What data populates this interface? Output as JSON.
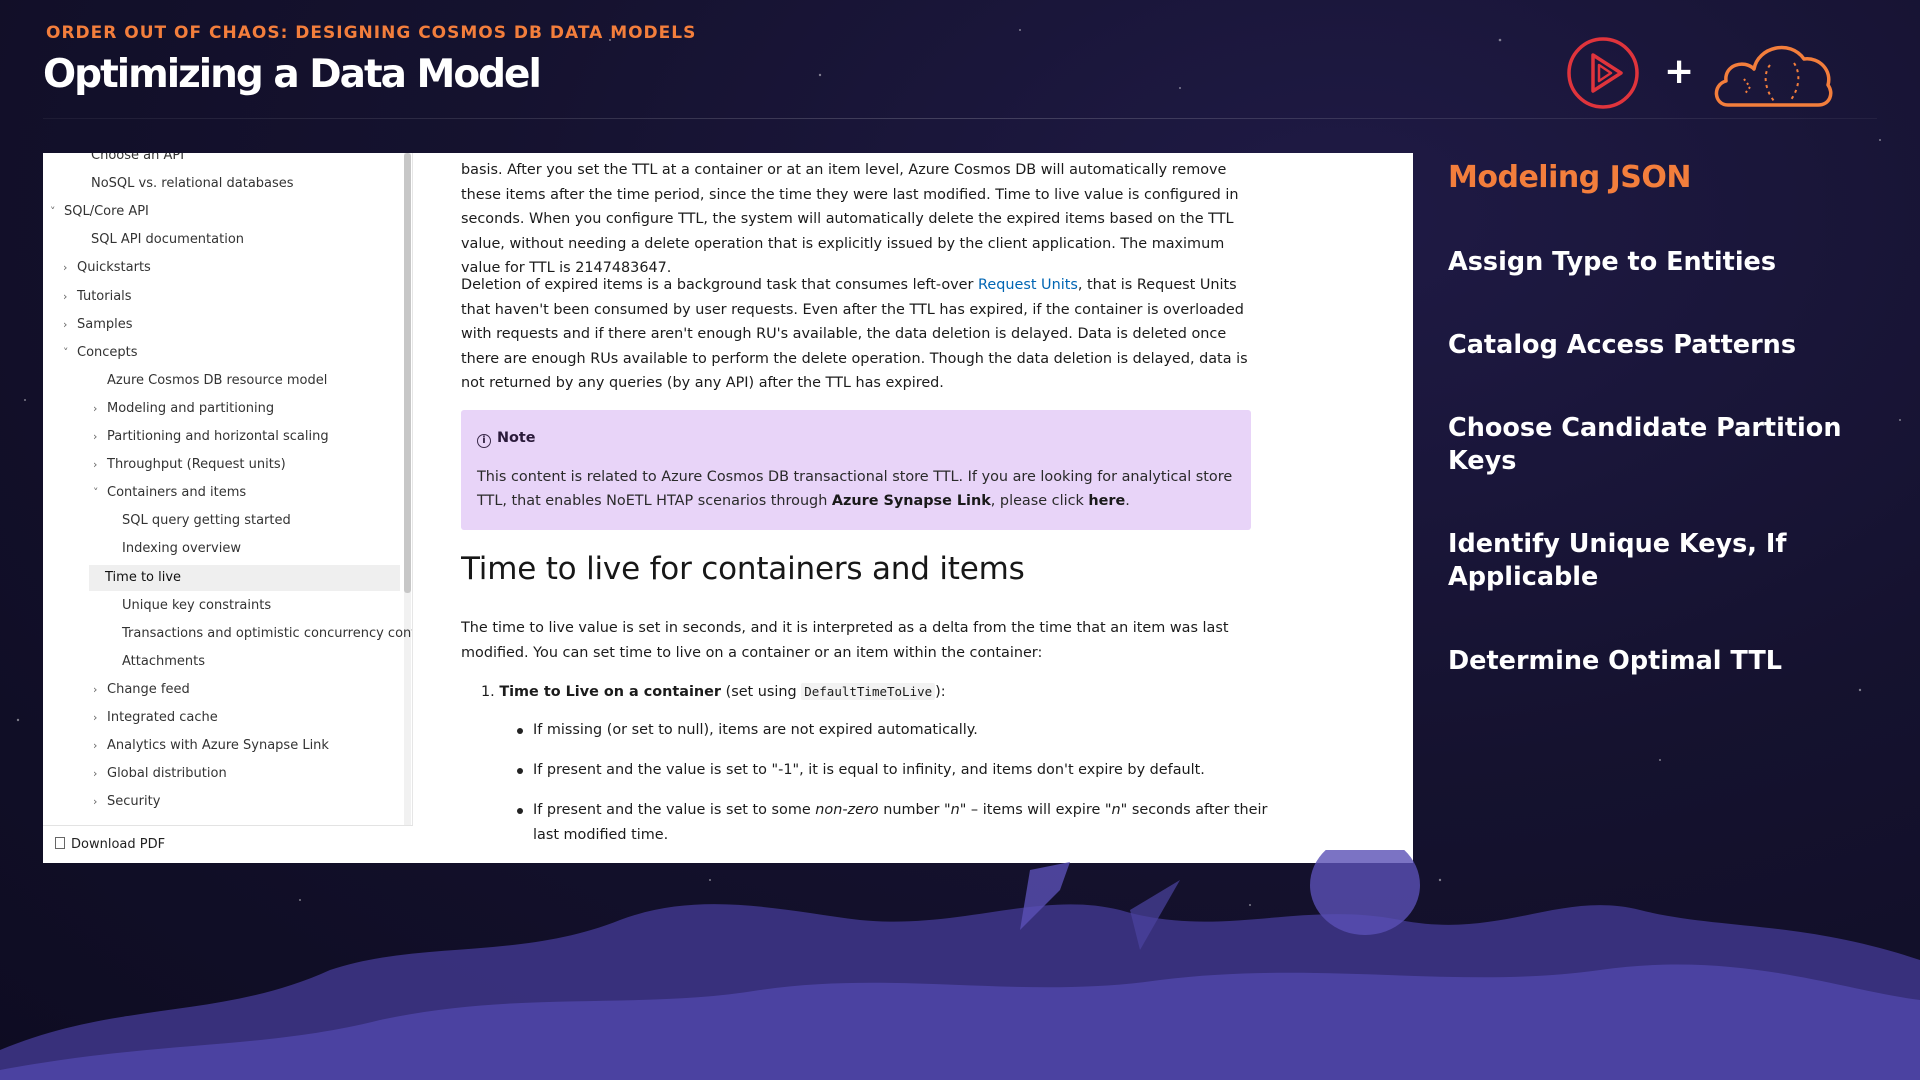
{
  "slide": {
    "eyebrow": "ORDER OUT OF CHAOS: DESIGNING COSMOS DB DATA MODELS",
    "title": "Optimizing a Data Model",
    "logo_left_icon": "play-icon",
    "plus": "+",
    "logo_right_icon": "cloud-icon"
  },
  "toc": {
    "items": [
      {
        "label": "Choose an API",
        "chev": ""
      },
      {
        "label": "NoSQL vs. relational databases",
        "chev": ""
      },
      {
        "label": "SQL/Core API",
        "chev": "v"
      },
      {
        "label": "SQL API documentation",
        "chev": ""
      },
      {
        "label": "Quickstarts",
        "chev": ">"
      },
      {
        "label": "Tutorials",
        "chev": ">"
      },
      {
        "label": "Samples",
        "chev": ">"
      },
      {
        "label": "Concepts",
        "chev": "v"
      },
      {
        "label": "Azure Cosmos DB resource model",
        "chev": ""
      },
      {
        "label": "Modeling and partitioning",
        "chev": ">"
      },
      {
        "label": "Partitioning and horizontal scaling",
        "chev": ">"
      },
      {
        "label": "Throughput (Request units)",
        "chev": ">"
      },
      {
        "label": "Containers and items",
        "chev": "v"
      },
      {
        "label": "SQL query getting started",
        "chev": ""
      },
      {
        "label": "Indexing overview",
        "chev": ""
      },
      {
        "label": "Time to live",
        "chev": ""
      },
      {
        "label": "Unique key constraints",
        "chev": ""
      },
      {
        "label": "Transactions and optimistic concurrency control",
        "chev": ""
      },
      {
        "label": "Attachments",
        "chev": ""
      },
      {
        "label": "Change feed",
        "chev": ">"
      },
      {
        "label": "Integrated cache",
        "chev": ">"
      },
      {
        "label": "Analytics with Azure Synapse Link",
        "chev": ">"
      },
      {
        "label": "Global distribution",
        "chev": ">"
      },
      {
        "label": "Security",
        "chev": ">"
      }
    ],
    "download_label": "Download PDF"
  },
  "article": {
    "p1": "basis. After you set the TTL at a container or at an item level, Azure Cosmos DB will automatically remove these items after the time period, since the time they were last modified. Time to live value is configured in seconds. When you configure TTL, the system will automatically delete the expired items based on the TTL value, without needing a delete operation that is explicitly issued by the client application. The maximum value for TTL is 2147483647.",
    "p2_before": "Deletion of expired items is a background task that consumes left-over ",
    "p2_link": "Request Units",
    "p2_after": ", that is Request Units that haven't been consumed by user requests. Even after the TTL has expired, if the container is overloaded with requests and if there aren't enough RU's available, the data deletion is delayed. Data is deleted once there are enough RUs available to perform the delete operation. Though the data deletion is delayed, data is not returned by any queries (by any API) after the TTL has expired.",
    "note_title": "Note",
    "note_before": "This content is related to Azure Cosmos DB transactional store TTL. If you are looking for analytical store TTL, that enables NoETL HTAP scenarios through ",
    "note_bold": "Azure Synapse Link",
    "note_mid": ", please click ",
    "note_link": "here",
    "note_end": ".",
    "heading": "Time to live for containers and items",
    "p3": "The time to live value is set in seconds, and it is interpreted as a delta from the time that an item was last modified. You can set time to live on a container or an item within the container:",
    "li_num": "1.",
    "li_bold": "Time to Live on a container",
    "li_mid": " (set using ",
    "li_code": "DefaultTimeToLive",
    "li_end": "):",
    "bullets": [
      {
        "text": "If missing (or set to null), items are not expired automatically."
      },
      {
        "text": "If present and the value is set to \"-1\", it is equal to infinity, and items don't expire by default."
      }
    ],
    "b3_before": "If present and the value is set to some ",
    "b3_em1": "non-zero",
    "b3_mid": " number ",
    "b3_em2": "\"n\"",
    "b3_mid2": " – items will expire ",
    "b3_em3": "\"n\"",
    "b3_end": " seconds after their last modified time."
  },
  "agenda": {
    "heading": "Modeling JSON",
    "items": [
      "Assign Type to Entities",
      "Catalog Access Patterns",
      "Choose Candidate Partition Keys",
      "Identify Unique Keys, If Applicable",
      "Determine Optimal TTL"
    ]
  },
  "colors": {
    "accent": "#f37e3c",
    "logo_red": "#e0343c",
    "background": "#15122f",
    "note_bg": "#e8d4f8",
    "link": "#0065b3"
  }
}
